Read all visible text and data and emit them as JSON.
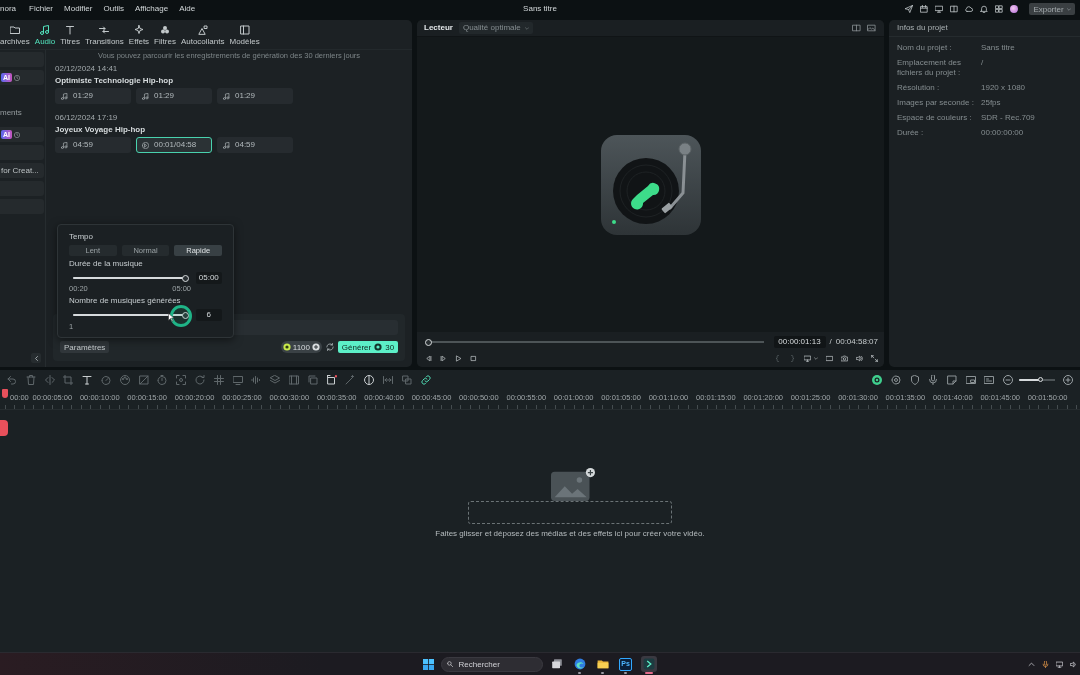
{
  "menubar": {
    "app_name": "nora",
    "menus": [
      "Fichier",
      "Modifier",
      "Outils",
      "Affichage",
      "Aide"
    ],
    "title": "Sans titre",
    "export_button": {
      "label": "Exporter",
      "disabled": true
    }
  },
  "library": {
    "tabs": [
      {
        "label": "archives",
        "selected": false
      },
      {
        "label": "Audio",
        "selected": true
      },
      {
        "label": "Titres",
        "selected": false
      },
      {
        "label": "Transitions",
        "selected": false
      },
      {
        "label": "Effets",
        "selected": false
      },
      {
        "label": "Filtres",
        "selected": false
      },
      {
        "label": "Autocollants",
        "selected": false
      },
      {
        "label": "Modèles",
        "selected": false
      }
    ],
    "sidebar": [
      {
        "kind": "row"
      },
      {
        "kind": "row",
        "badge": "AI"
      },
      {
        "kind": "heading",
        "label": "ments"
      },
      {
        "kind": "row",
        "badge": "AI"
      },
      {
        "kind": "row"
      },
      {
        "kind": "row",
        "label": "for Creat..."
      },
      {
        "kind": "row"
      },
      {
        "kind": "row"
      }
    ],
    "notice": "Vous pouvez parcourir les enregistrements de génération des 30 derniers jours",
    "groups": [
      {
        "date": "02/12/2024 14:41",
        "title": "Optimiste Technologie Hip-hop",
        "tracks": [
          {
            "duration": "01:29",
            "selected": false
          },
          {
            "duration": "01:29",
            "selected": false
          },
          {
            "duration": "01:29",
            "selected": false
          }
        ]
      },
      {
        "date": "06/12/2024 17:19",
        "title": "Joyeux Voyage Hip-hop",
        "tracks": [
          {
            "duration": "04:59",
            "selected": false
          },
          {
            "duration": "00:01/04:58",
            "selected": true
          },
          {
            "duration": "04:59",
            "selected": false
          }
        ]
      }
    ],
    "settings_popup": {
      "tempo": {
        "label": "Tempo",
        "options": [
          {
            "label": "Lent",
            "selected": false
          },
          {
            "label": "Normal",
            "selected": false
          },
          {
            "label": "Rapide",
            "selected": true
          }
        ]
      },
      "duration": {
        "label": "Durée de la musique",
        "level": 1,
        "min": "00:20",
        "max": "05:00",
        "value": "05:00"
      },
      "count": {
        "label": "Nombre de musiques générées",
        "level": 1,
        "min": "1",
        "value": "6"
      }
    },
    "prompt": {
      "params_button": "Paramètres",
      "credits": "1100",
      "generate_button": "Générer",
      "generate_cost": "30"
    }
  },
  "player": {
    "label": "Lecteur",
    "quality": {
      "value": "Qualité optimale",
      "disabled": true
    },
    "progress": {
      "level": 0
    },
    "current_time": "00:00:01:13",
    "separator": "/",
    "total_time": "00:04:58:07"
  },
  "project_info": {
    "title": "Infos du projet",
    "rows": [
      {
        "label": "Nom du projet :",
        "value": "Sans titre"
      },
      {
        "label": "Emplacement des fichiers du projet :",
        "value": "/"
      },
      {
        "label": "Résolution :",
        "value": "1920 x 1080"
      },
      {
        "label": "Images par seconde :",
        "value": "25fps"
      },
      {
        "label": "Espace de couleurs :",
        "value": "SDR - Rec.709"
      },
      {
        "label": "Durée :",
        "value": "00:00:00:00"
      }
    ]
  },
  "timeline": {
    "ruler": [
      "00:00",
      "00:00:05:00",
      "00:00:10:00",
      "00:00:15:00",
      "00:00:20:00",
      "00:00:25:00",
      "00:00:30:00",
      "00:00:35:00",
      "00:00:40:00",
      "00:00:45:00",
      "00:00:50:00",
      "00:00:55:00",
      "00:01:00:00",
      "00:01:05:00",
      "00:01:10:00",
      "00:01:15:00",
      "00:01:20:00",
      "00:01:25:00",
      "00:01:30:00",
      "00:01:35:00",
      "00:01:40:00",
      "00:01:45:00",
      "00:01:50:00"
    ],
    "zoom": {
      "level": 0.6
    },
    "drop_hint": "Faites glisser et déposez des médias et des effets ici pour créer votre vidéo."
  },
  "taskbar": {
    "search_placeholder": "Rechercher",
    "apps": [
      {
        "kind": "task-view",
        "open": false,
        "selected": false
      },
      {
        "kind": "browser",
        "open": true,
        "selected": false
      },
      {
        "kind": "folder",
        "open": true,
        "selected": false
      },
      {
        "kind": "tile",
        "label": "Ps",
        "open": true,
        "selected": false
      },
      {
        "kind": "editor",
        "open": true,
        "selected": true
      }
    ]
  }
}
